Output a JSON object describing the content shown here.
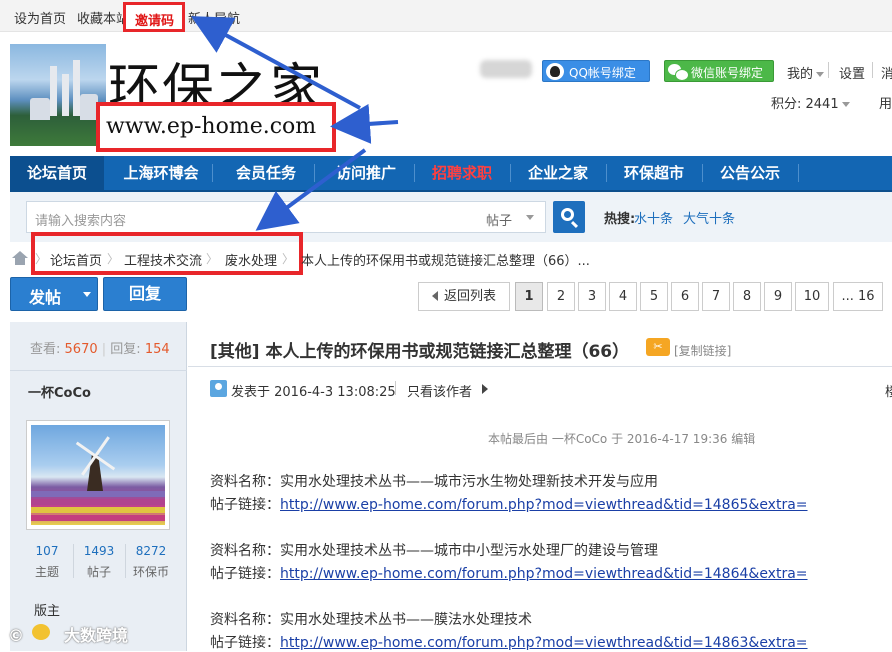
{
  "topbar": {
    "set_home": "设为首页",
    "favorite": "收藏本站",
    "invite": "邀请码",
    "guide": "新人导航"
  },
  "header": {
    "site_title": "环保之家",
    "site_url": "www.ep-home.com",
    "qq_bind": "QQ帐号绑定",
    "wechat_bind": "微信账号绑定",
    "my": "我的",
    "settings": "设置",
    "logout": "消",
    "points": "积分: 2441",
    "user_edge": "用"
  },
  "nav": {
    "items": [
      {
        "label": "论坛首页",
        "active": true
      },
      {
        "label": "上海环博会"
      },
      {
        "label": "会员任务"
      },
      {
        "label": "访问推广"
      },
      {
        "label": "招聘求职",
        "highlight": "#ff4040"
      },
      {
        "label": "企业之家"
      },
      {
        "label": "环保超市"
      },
      {
        "label": "公告公示"
      }
    ]
  },
  "search": {
    "placeholder": "请输入搜索内容",
    "scope": "帖子",
    "hot_label": "热搜:",
    "hot": [
      "水十条",
      "大气十条"
    ]
  },
  "breadcrumb": {
    "items": [
      "论坛首页",
      "工程技术交流",
      "废水处理"
    ],
    "current": "本人上传的环保用书或规范链接汇总整理（66）..."
  },
  "actions": {
    "post": "发帖",
    "reply": "回复"
  },
  "pagination": {
    "back": "返回列表",
    "pages": [
      "1",
      "2",
      "3",
      "4",
      "5",
      "6",
      "7",
      "8",
      "9",
      "10",
      "... 16"
    ],
    "current": "1"
  },
  "sidebar": {
    "views_label": "查看:",
    "views": "5670",
    "replies_label": "回复:",
    "replies": "154",
    "author": "一杯CoCo",
    "stats": [
      {
        "num": "107",
        "label": "主题"
      },
      {
        "num": "1493",
        "label": "帖子"
      },
      {
        "num": "8272",
        "label": "环保币"
      }
    ],
    "rank": "版主"
  },
  "thread": {
    "title": "[其他] 本人上传的环保用书或规范链接汇总整理（66）",
    "copy_link": "[复制链接]",
    "posted_at": "发表于 2016-4-3 13:08:25",
    "only_author": "只看该作者",
    "edge_char": "楼",
    "edit_note": "本帖最后由 一杯CoCo 于 2016-4-17 19:36 编辑",
    "resources": [
      {
        "name": "资料名称：实用水处理技术丛书——城市污水生物处理新技术开发与应用",
        "link_label": "帖子链接：",
        "link": "http://www.ep-home.com/forum.php?mod=viewthread&tid=14865&extra="
      },
      {
        "name": "资料名称：实用水处理技术丛书——城市中小型污水处理厂的建设与管理",
        "link_label": "帖子链接：",
        "link": "http://www.ep-home.com/forum.php?mod=viewthread&tid=14864&extra="
      },
      {
        "name": "资料名称：实用水处理技术丛书——膜法水处理技术",
        "link_label": "帖子链接：",
        "link": "http://www.ep-home.com/forum.php?mod=viewthread&tid=14863&extra="
      }
    ]
  },
  "watermark": "大数跨境",
  "colors": {
    "nav_blue": "#1366b3",
    "annotation_red": "#e8262a",
    "arrow_blue": "#2e5fcf",
    "link_blue": "#1a3fa6"
  }
}
